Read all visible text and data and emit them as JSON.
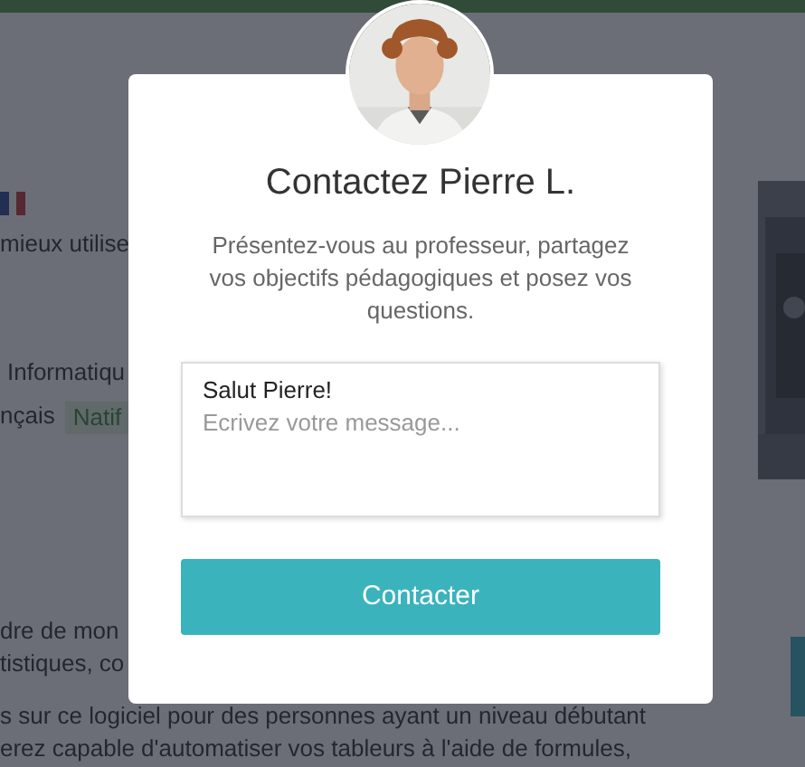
{
  "background": {
    "intro": "mieux utilise",
    "subject": "Informatiqu",
    "language": {
      "name": "nçais",
      "level": "Natif"
    },
    "paragraph": [
      "dre de mon",
      "tistiques, co",
      "s sur ce logiciel pour des personnes ayant un niveau débutant",
      "erez capable d'automatiser vos tableurs à l'aide de formules,"
    ]
  },
  "modal": {
    "title": "Contactez Pierre L.",
    "description": "Présentez-vous au professeur, partagez vos objectifs pédagogiques et posez vos questions.",
    "message": {
      "value": "Salut Pierre!",
      "placeholder": "Ecrivez votre message..."
    },
    "button": "Contacter"
  }
}
